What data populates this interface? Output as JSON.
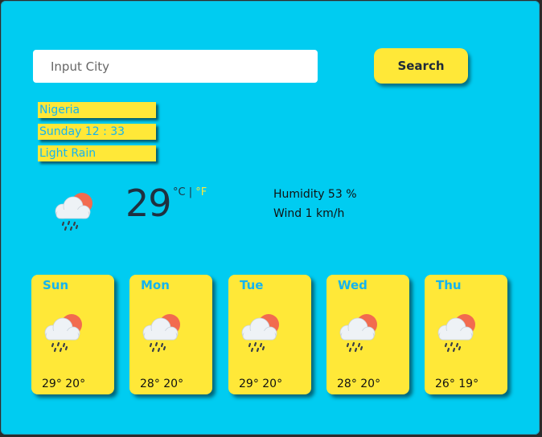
{
  "search": {
    "placeholder": "Input City",
    "value": "",
    "button_label": "Search"
  },
  "location": {
    "country": "Nigeria",
    "day_time": "Sunday 12 : 33",
    "condition": "Light Rain"
  },
  "current": {
    "icon": "sun-cloud-rain-icon",
    "temperature": "29",
    "unit_c": "°C",
    "unit_sep": "|",
    "unit_f": "°F",
    "humidity": "Humidity 53 %",
    "wind": "Wind 1 km/h"
  },
  "forecast": [
    {
      "day": "Sun",
      "temps": "29° 20°",
      "icon": "sun-cloud-rain-icon"
    },
    {
      "day": "Mon",
      "temps": "28° 20°",
      "icon": "sun-cloud-rain-icon"
    },
    {
      "day": "Tue",
      "temps": "29° 20°",
      "icon": "sun-cloud-rain-icon"
    },
    {
      "day": "Wed",
      "temps": "28° 20°",
      "icon": "sun-cloud-rain-icon"
    },
    {
      "day": "Thu",
      "temps": "26° 19°",
      "icon": "sun-cloud-rain-icon"
    }
  ],
  "colors": {
    "background": "#00ccf1",
    "accent_yellow": "#ffe838",
    "accent_blue_text": "#14b4f0",
    "sun": "#f26b4f",
    "cloud": "#eef2f6"
  }
}
